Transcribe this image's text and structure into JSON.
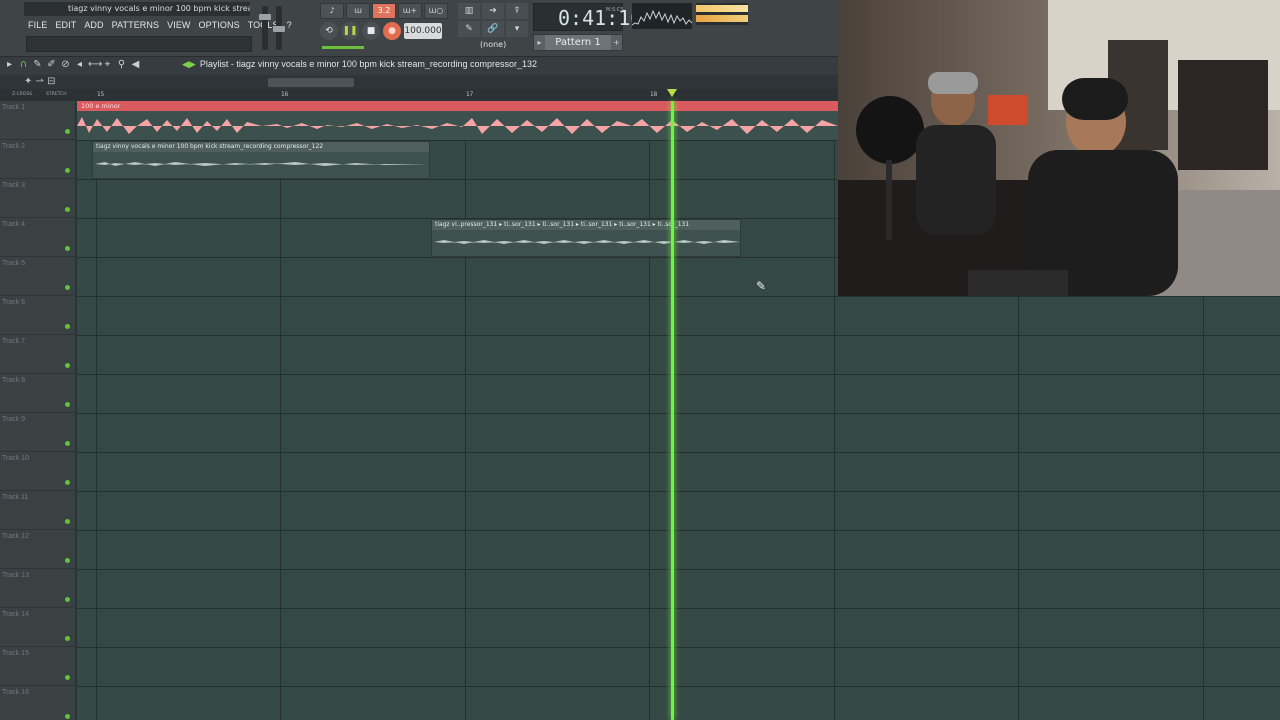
{
  "window": {
    "title": "tiagz vinny vocals e minor 100 bpm kick stream...",
    "minimize_icon": "minimize-icon",
    "restore_icon": "restore-icon",
    "close_icon": "close-icon"
  },
  "menu": [
    "FILE",
    "EDIT",
    "ADD",
    "PATTERNS",
    "VIEW",
    "OPTIONS",
    "TOOLS",
    "?"
  ],
  "transport": {
    "tempo": "100.000",
    "pattern_mode_label": "3.2",
    "play_state": "paused",
    "record_icon": "record-icon"
  },
  "time": {
    "value": "0:41:10",
    "unit": "M:S:CS"
  },
  "pattern": {
    "label": "Pattern 1",
    "channel_select": "(none)"
  },
  "playlist": {
    "title": "Playlist - tiagz vinny vocals e minor 100 bpm kick stream_recording compressor_132",
    "zero_cross_label": "Z-CROSS",
    "stretch_label": "STRETCH",
    "ruler_bars": [
      "15",
      "16",
      "17",
      "18"
    ]
  },
  "tracks": [
    "Track 1",
    "Track 2",
    "Track 3",
    "Track 4",
    "Track 5",
    "Track 6",
    "Track 7",
    "Track 8",
    "Track 9",
    "Track 10",
    "Track 11",
    "Track 12",
    "Track 13",
    "Track 14",
    "Track 15",
    "Track 16"
  ],
  "clips": {
    "track1": {
      "label": "100 e minor",
      "color": "#d95a5f"
    },
    "track2": {
      "label": "tiagz vinny vocals e minor 100 bpm kick stream_recording compressor_122"
    },
    "track4": {
      "label": "tiagz vi..pressor_131 ▸ ti..sor_131 ▸ ti..sor_131 ▸ ti..sor_131 ▸ ti..sor_131 ▸ ti..sor_131"
    }
  },
  "colors": {
    "accent_green": "#6ef53e",
    "record_red": "#e26b50",
    "grid_bg": "#344845"
  }
}
